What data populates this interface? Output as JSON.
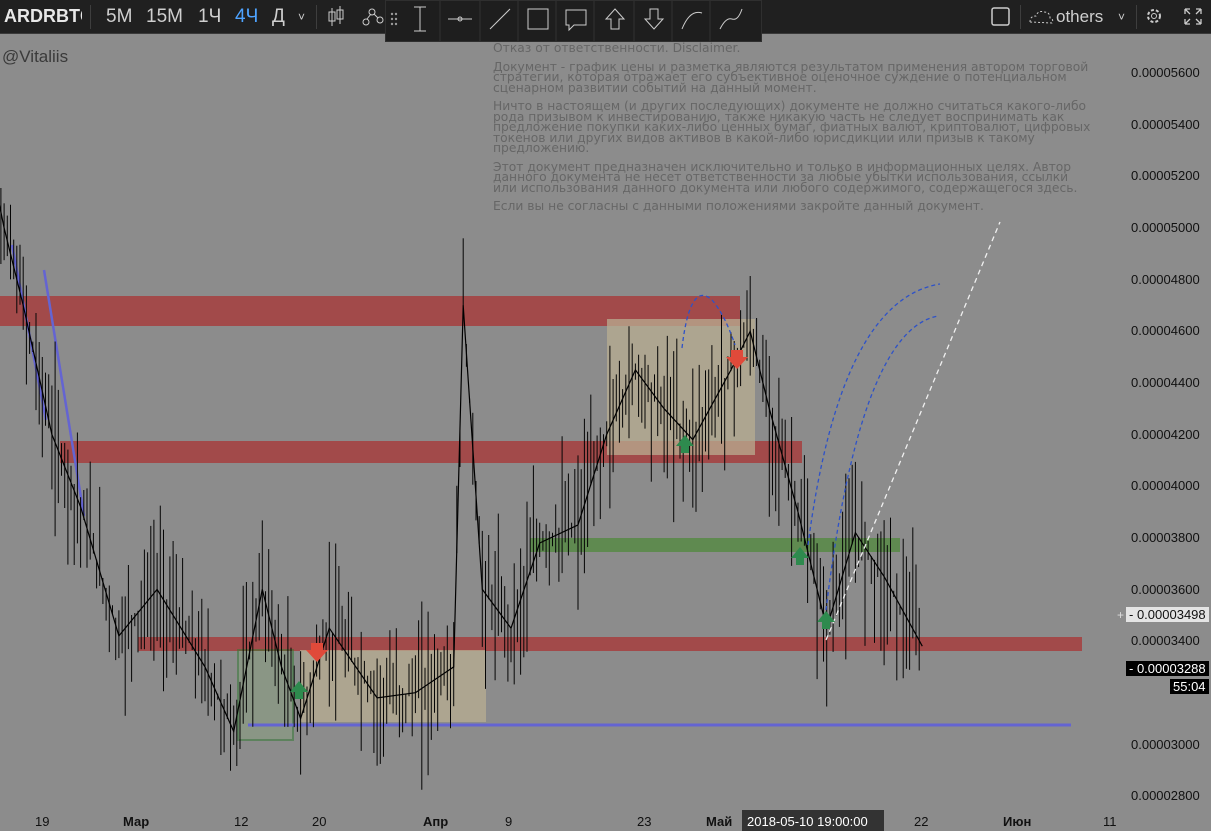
{
  "toolbar": {
    "symbol": "ARDRBTC",
    "intervals": [
      "5М",
      "15М",
      "1Ч",
      "4Ч",
      "Д"
    ],
    "active_interval": "4Ч",
    "others_label": "others"
  },
  "watermark": "@Vitaliis",
  "disclaimer": [
    "Отказ от ответственности. Disclaimer.",
    "Документ - график цены и разметка являются результатом применения автором торговой стратегии, которая отражает его субъективное оценочное суждение о потенциальном сценарном развитии событий на данный момент.",
    "Ничто в настоящем (и других последующих) документе не должно считаться какого-либо рода призывом к инвестированию, также никакую часть не следует воспринимать как предложение покупки каких-либо ценных бумаг, фиатных валют, криптовалют, цифровых токенов или других видов активов в какой-либо юрисдикции или призыв к такому предложению.",
    "Этот документ предназначен исключительно и только в информационных целях. Автор данного документа не несет ответственности за любые убытки использования, ссылки или использования данного документа или любого содержимого, содержащегося здесь.",
    "Если вы не согласны с данными положениями закройте данный документ."
  ],
  "chart_data": {
    "type": "candlestick",
    "symbol": "ARDRBTC",
    "interval": "4Ч",
    "ylim": [
      2.8e-05,
      5.66e-05
    ],
    "y_ticks": [
      "0.00005600",
      "0.00005400",
      "0.00005200",
      "0.00005000",
      "0.00004800",
      "0.00004600",
      "0.00004400",
      "0.00004200",
      "0.00004000",
      "0.00003800",
      "0.00003600",
      "0.00003400",
      "0.00003000",
      "0.00002800"
    ],
    "x_ticks": [
      "19",
      "Мар",
      "12",
      "20",
      "Апр",
      "9",
      "23",
      "Май",
      "22",
      "Июн",
      "11"
    ],
    "crosshair_date": "2018-05-10 19:00:00",
    "crosshair_price": "0.00003498",
    "last_price": "0.00003288",
    "countdown": "55:04",
    "zones": [
      {
        "type": "resistance",
        "color": "#a24a4a",
        "from": "start",
        "to": "Май",
        "y": [
          4.62e-05,
          4.74e-05
        ]
      },
      {
        "type": "resistance",
        "color": "#a24a4a",
        "from": "~17 Feb",
        "to": "~10 May",
        "y": [
          4.1e-05,
          4.18e-05
        ]
      },
      {
        "type": "support",
        "color": "#5f8a50",
        "from": "~9 Apr",
        "to": "~21 May",
        "y": [
          3.75e-05,
          3.8e-05
        ]
      },
      {
        "type": "support",
        "color": "#a24a4a",
        "from": "~27 Feb",
        "to": "~30 May",
        "y": [
          3.35e-05,
          3.4e-05
        ]
      },
      {
        "type": "line",
        "color": "#6464d2",
        "from": "~12 Mar",
        "to": "~8 Jun",
        "y": [
          3.07e-05
        ]
      }
    ],
    "series": [
      {
        "name": "price path",
        "points": [
          [
            "Feb 12",
            5.55e-05
          ],
          [
            "Feb 15",
            5e-05
          ],
          [
            "Feb 17",
            4.7e-05
          ],
          [
            "Feb 20",
            4.2e-05
          ],
          [
            "Feb 23",
            3.92e-05
          ],
          [
            "Feb 27",
            3.42e-05
          ],
          [
            "Mar 3",
            3.6e-05
          ],
          [
            "Mar 8",
            3.3e-05
          ],
          [
            "Mar 11",
            3.05e-05
          ],
          [
            "Mar 14",
            3.6e-05
          ],
          [
            "Mar 16",
            3.3e-05
          ],
          [
            "Mar 18",
            3.1e-05
          ],
          [
            "Mar 21",
            3.45e-05
          ],
          [
            "Mar 26",
            3.18e-05
          ],
          [
            "Mar 30",
            3.2e-05
          ],
          [
            "Apr 3",
            3.3e-05
          ],
          [
            "Apr 4",
            4.7e-05
          ],
          [
            "Apr 6",
            3.6e-05
          ],
          [
            "Apr 9",
            3.45e-05
          ],
          [
            "Apr 12",
            3.78e-05
          ],
          [
            "Apr 16",
            3.85e-05
          ],
          [
            "Apr 19",
            4.2e-05
          ],
          [
            "Apr 22",
            4.45e-05
          ],
          [
            "Apr 25",
            4.3e-05
          ],
          [
            "Apr 28",
            4.18e-05
          ],
          [
            "May 2",
            4.45e-05
          ],
          [
            "May 4",
            4.6e-05
          ],
          [
            "May 6",
            4.3e-05
          ],
          [
            "May 9",
            3.9e-05
          ],
          [
            "May 12",
            3.45e-05
          ],
          [
            "May 15",
            3.82e-05
          ],
          [
            "May 18",
            3.65e-05
          ],
          [
            "May 22",
            3.38e-05
          ]
        ]
      }
    ]
  }
}
